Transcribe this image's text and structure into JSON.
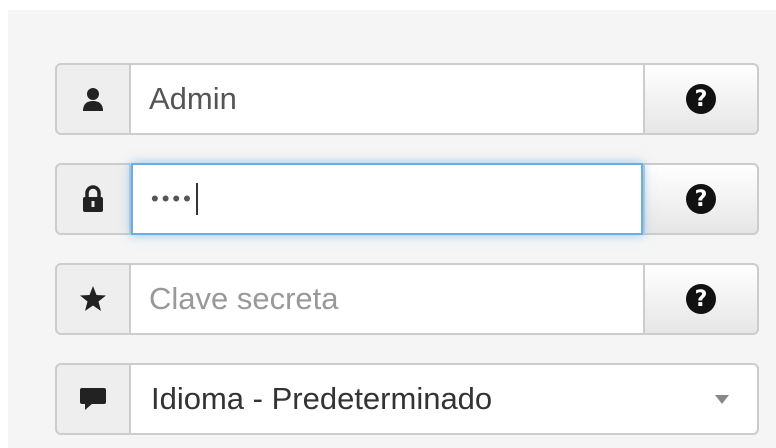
{
  "form": {
    "username": {
      "value": "Admin",
      "icon": "user-icon"
    },
    "password": {
      "masked_value": "••••",
      "icon": "lock-icon",
      "focused": true
    },
    "secret_key": {
      "placeholder": "Clave secreta",
      "value": "",
      "icon": "star-icon"
    },
    "language": {
      "selected": "Idioma - Predeterminado",
      "icon": "comment-icon"
    },
    "help_icon": "question-circle-icon",
    "help_label": "?"
  },
  "colors": {
    "focus_border": "#66afe9",
    "addon_bg": "#eeeeee",
    "panel_bg": "#f5f5f5"
  }
}
